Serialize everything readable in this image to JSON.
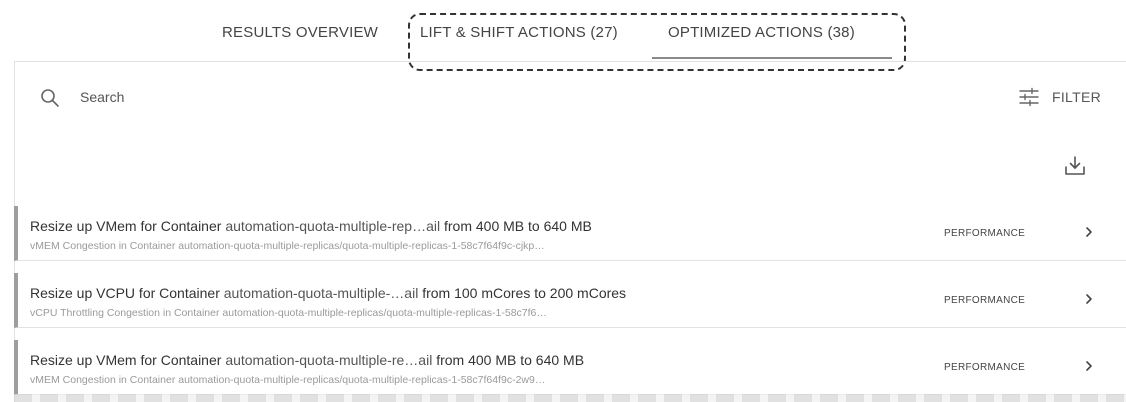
{
  "tabs": [
    {
      "label": "RESULTS OVERVIEW"
    },
    {
      "label": "LIFT & SHIFT ACTIONS (27)"
    },
    {
      "label": "OPTIMIZED ACTIONS (38)"
    }
  ],
  "active_tab": "OPTIMIZED ACTIONS (38)",
  "search": {
    "placeholder": "Search",
    "value": ""
  },
  "filter": {
    "label": "FILTER"
  },
  "icons": {
    "search": "search-icon",
    "filter": "sliders-icon",
    "download": "download-icon",
    "row": "chevron-right-icon"
  },
  "colors": {
    "row_accent": "#9e9e9e",
    "callout_border": "#333333"
  },
  "actions": [
    {
      "title_prefix": "Resize up VMem for Container ",
      "entity": "automation-quota-multiple-rep…ail",
      "title_suffix": " from 400 MB to 640 MB",
      "subtitle": "vMEM Congestion in Container automation-quota-multiple-replicas/quota-multiple-replicas-1-58c7f64f9c-cjkp…",
      "category": "PERFORMANCE"
    },
    {
      "title_prefix": "Resize up VCPU for Container ",
      "entity": "automation-quota-multiple-…ail",
      "title_suffix": " from 100 mCores to 200 mCores",
      "subtitle": "vCPU Throttling Congestion in Container automation-quota-multiple-replicas/quota-multiple-replicas-1-58c7f6…",
      "category": "PERFORMANCE"
    },
    {
      "title_prefix": "Resize up VMem for Container ",
      "entity": "automation-quota-multiple-re…ail",
      "title_suffix": " from 400 MB to 640 MB",
      "subtitle": "vMEM Congestion in Container automation-quota-multiple-replicas/quota-multiple-replicas-1-58c7f64f9c-2w9…",
      "category": "PERFORMANCE"
    }
  ]
}
